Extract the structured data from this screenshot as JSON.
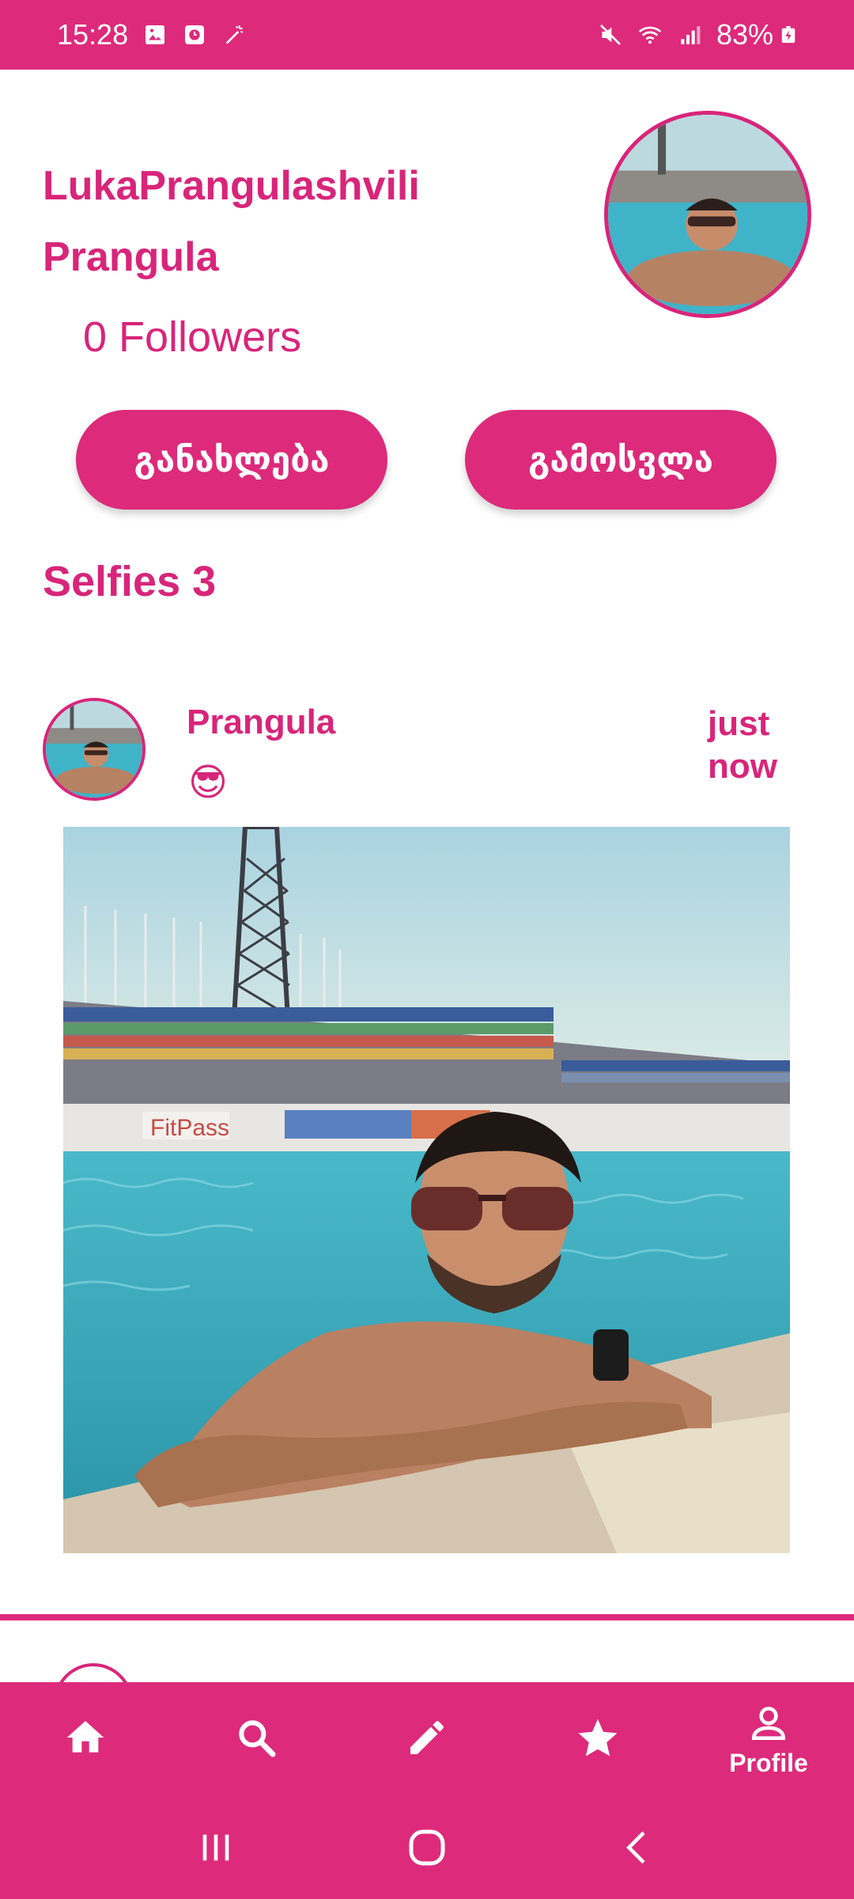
{
  "status_bar": {
    "time": "15:28",
    "battery": "83%",
    "icons": [
      "gallery-icon",
      "alarm-icon",
      "magic-wand-icon",
      "mute-icon",
      "wifi-icon",
      "signal-icon",
      "battery-charging-icon"
    ]
  },
  "profile": {
    "username": "LukaPrangulashvili",
    "display_name": "Prangula",
    "followers": "0 Followers"
  },
  "actions": {
    "review_label": "განახლება",
    "logout_label": "გამოსვლა"
  },
  "selfies": {
    "title": "Selfies 3"
  },
  "post": {
    "author": "Prangula",
    "emoji": "😎",
    "time": "just now"
  },
  "bottom_nav": {
    "items": [
      {
        "icon": "home-icon",
        "label": ""
      },
      {
        "icon": "search-icon",
        "label": ""
      },
      {
        "icon": "pencil-icon",
        "label": ""
      },
      {
        "icon": "star-icon",
        "label": ""
      },
      {
        "icon": "person-icon",
        "label": "Profile"
      }
    ]
  },
  "colors": {
    "accent": "#dd2a7b",
    "text": "#d8257a"
  }
}
